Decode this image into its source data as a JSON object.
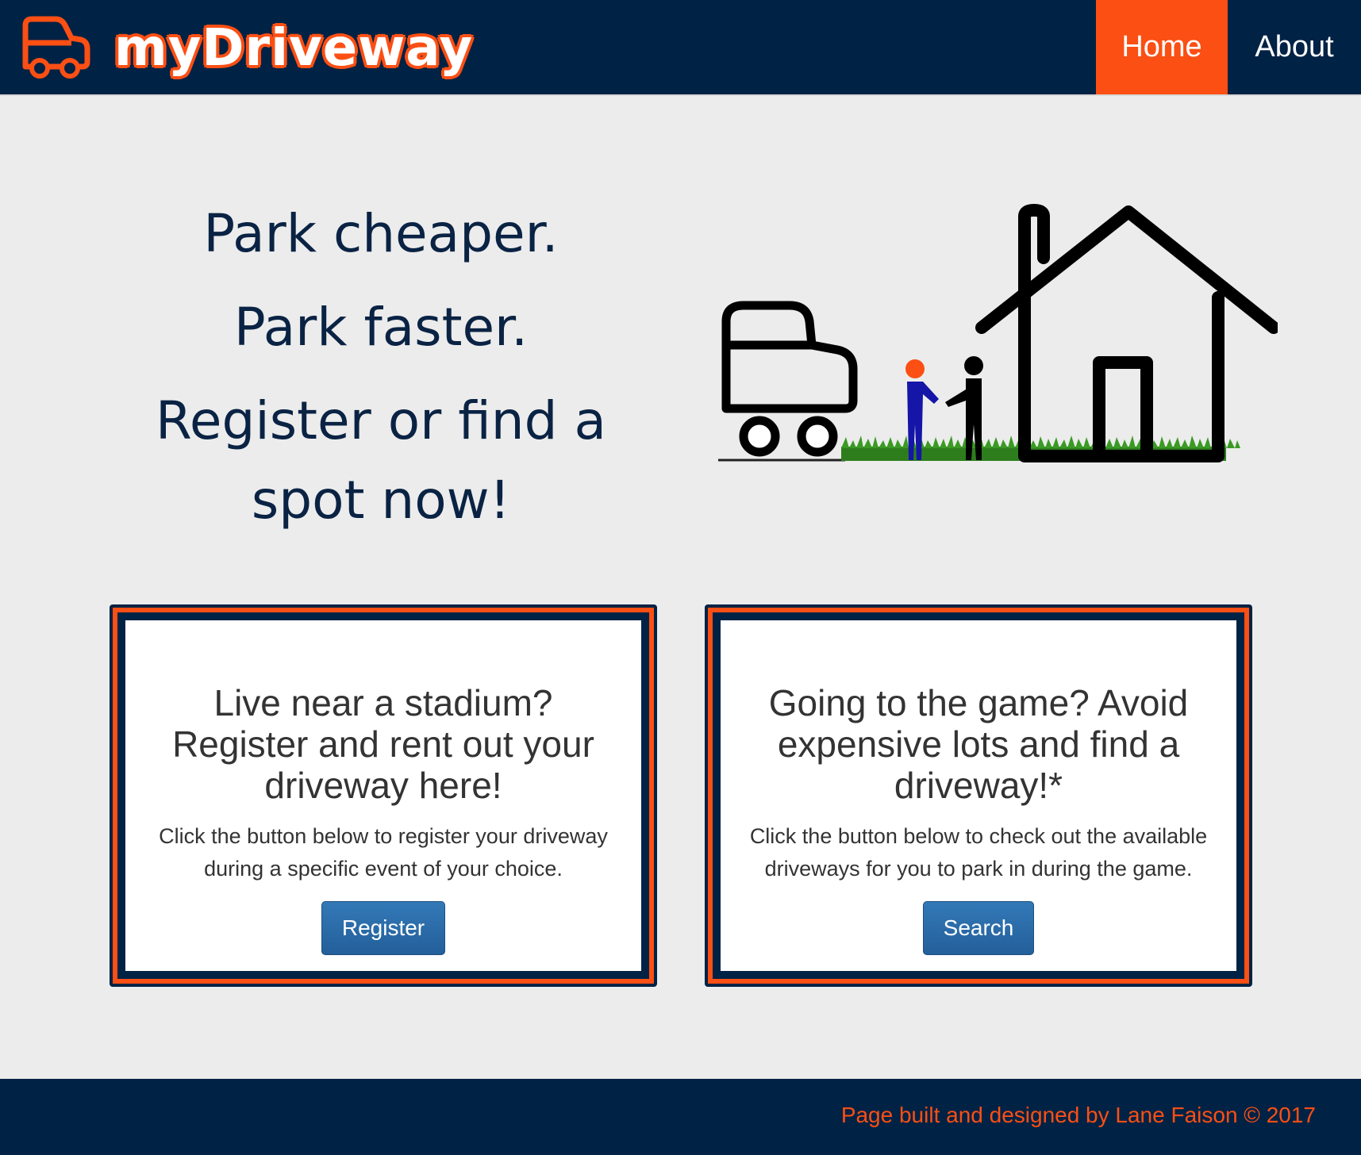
{
  "navbar": {
    "brand": "myDriveway",
    "links": [
      {
        "label": "Home",
        "active": true
      },
      {
        "label": "About",
        "active": false
      }
    ]
  },
  "hero": {
    "lines": [
      "Park cheaper.",
      "Park faster.",
      "Register or find a spot now!"
    ]
  },
  "cards": [
    {
      "title": "Live near a stadium? Register and rent out your driveway here!",
      "description": "Click the button below to register your driveway during a specific event of your choice.",
      "button": "Register"
    },
    {
      "title": "Going to the game? Avoid expensive lots and find a driveway!*",
      "description": "Click the button below to check out the available driveways for you to park in during the game.",
      "button": "Search"
    }
  ],
  "footer": {
    "text": "Page built and designed by Lane Faison © 2017"
  },
  "colors": {
    "navy": "#002244",
    "orange": "#fb4f14",
    "button_blue": "#2c6ca8",
    "background": "#ececec"
  }
}
